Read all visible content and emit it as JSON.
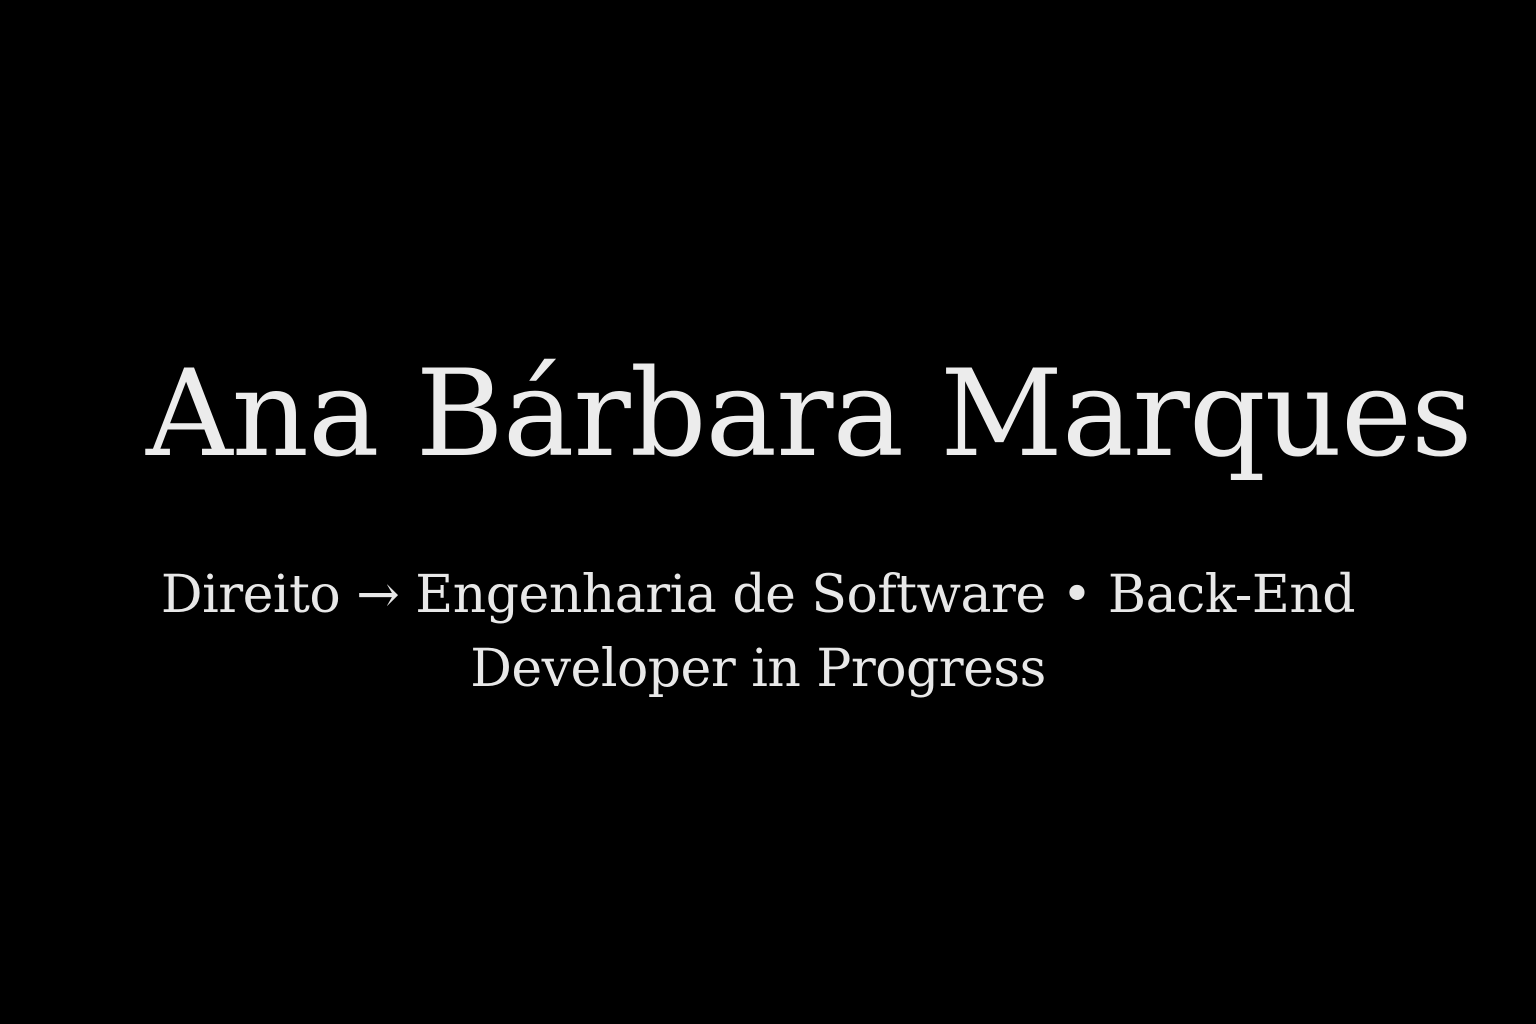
{
  "profile": {
    "name": "Ana Bárbara Marques",
    "tagline": "Direito → Engenharia de Software • Back-End Developer in Progress"
  },
  "colors": {
    "background": "#000000",
    "text": "#ececec"
  }
}
